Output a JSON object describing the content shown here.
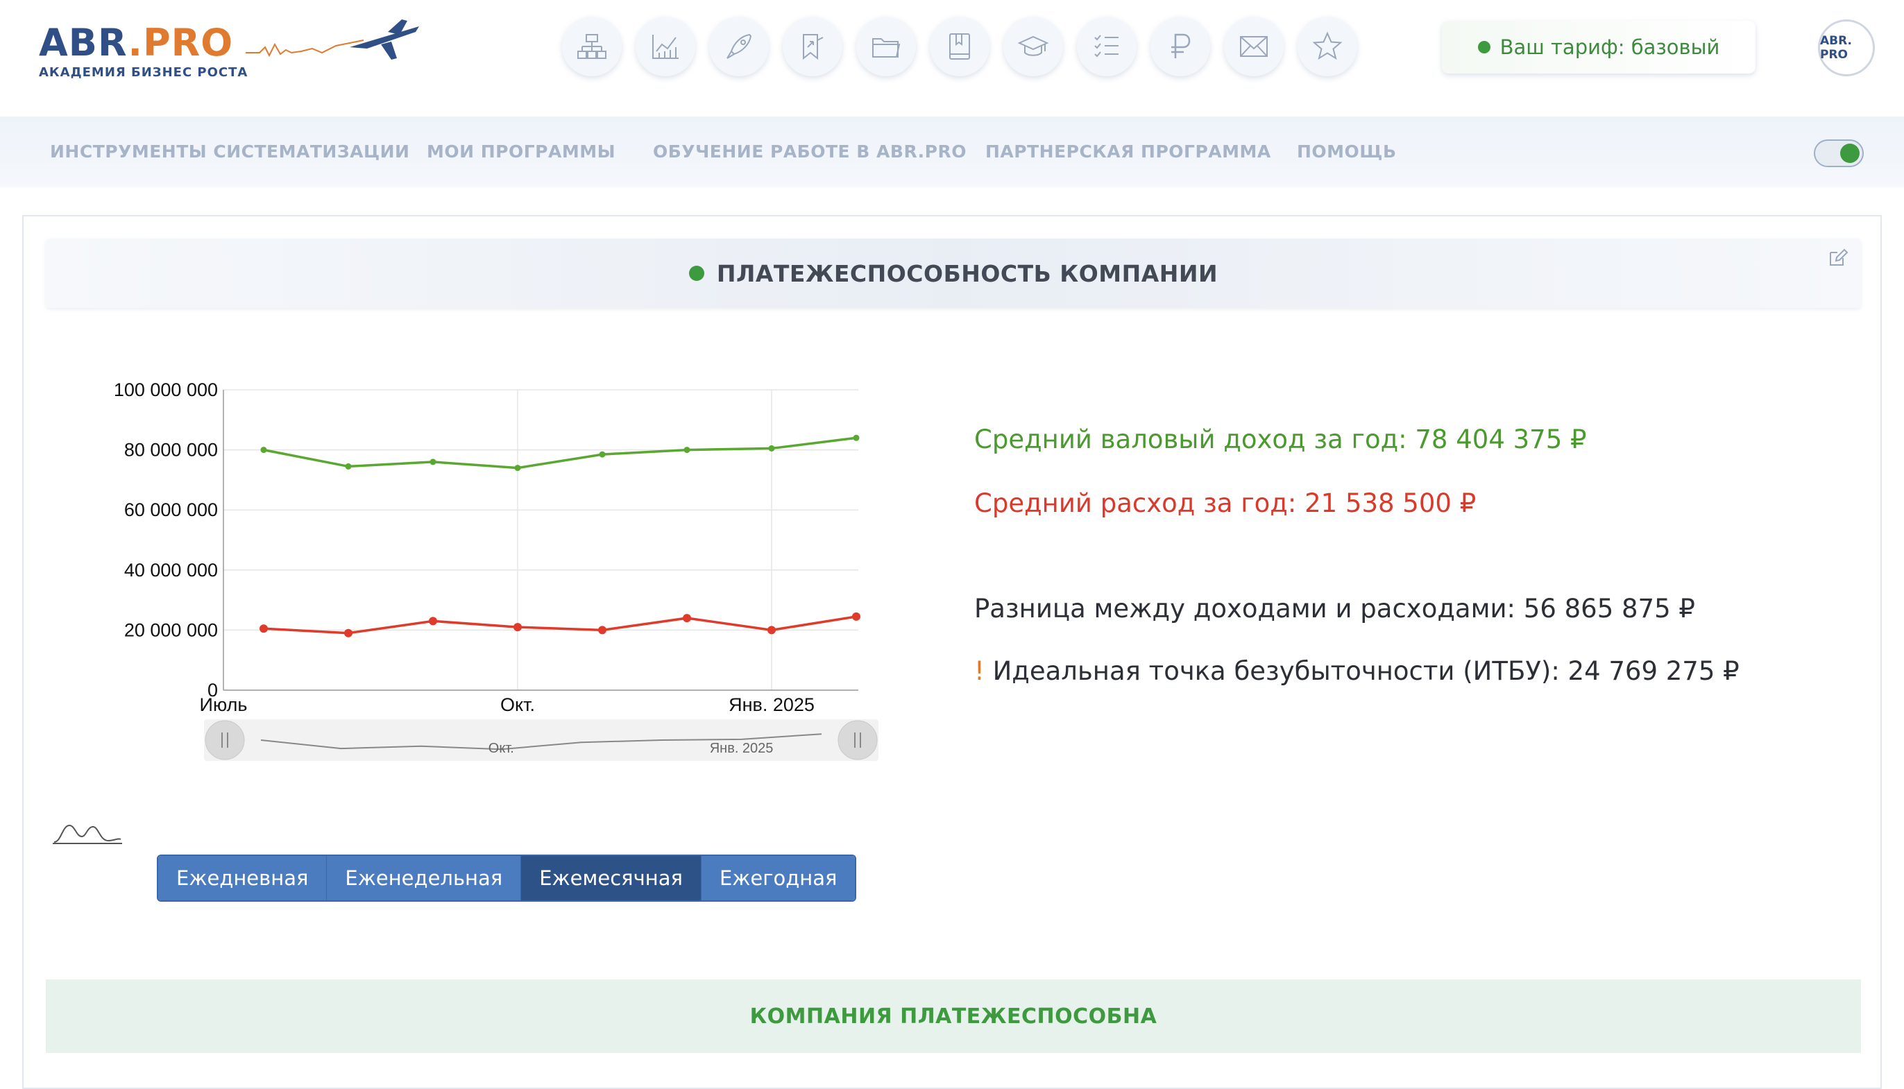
{
  "header": {
    "logo": {
      "abr": "ABR",
      "dot": ".",
      "pro": "PRO",
      "subtitle": "АКАДЕМИЯ БИЗНЕС РОСТА"
    },
    "icons": [
      "structure-icon",
      "chart-icon",
      "rocket-icon",
      "bookmark-icon",
      "folder-icon",
      "book-icon",
      "graduation-cap-icon",
      "checklist-icon",
      "ruble-icon",
      "mail-icon",
      "star-icon"
    ],
    "tariff": "Ваш тариф: базовый",
    "avatar_text": "ABR. PRO"
  },
  "nav": {
    "items": [
      "ИНСТРУМЕНТЫ СИСТЕМАТИЗАЦИИ",
      "МОИ ПРОГРАММЫ",
      "ОБУЧЕНИЕ РАБОТЕ В ABR.PRO",
      "ПАРТНЕРСКАЯ ПРОГРАММА",
      "ПОМОЩЬ"
    ],
    "toggle_on": true
  },
  "panel": {
    "title": "ПЛАТЕЖЕСПОСОБНОСТЬ КОМПАНИИ",
    "stats": {
      "income": "Средний валовый доход за год: 78 404 375 ₽",
      "expense": "Средний расход за год: 21 538 500 ₽",
      "diff": "Разница между доходами и расходами: 56 865 875 ₽",
      "itbu_mark": "!",
      "itbu": " Идеальная точка безубыточности (ИТБУ): 24 769 275 ₽"
    },
    "periods": [
      "Ежедневная",
      "Еженедельная",
      "Ежемесячная",
      "Ежегодная"
    ],
    "active_period": "Ежемесячная",
    "status": "КОМПАНИЯ ПЛАТЕЖЕСПОСОБНА"
  },
  "colors": {
    "income": "#5aa832",
    "expense": "#e03a2a",
    "accent_green": "#3e9a3e",
    "brand_blue": "#2f4f86",
    "brand_orange": "#e07a2e"
  },
  "chart_data": {
    "type": "line",
    "x": [
      "2024-07",
      "2024-08",
      "2024-09",
      "2024-10",
      "2024-11",
      "2024-12",
      "2025-01",
      "2025-02"
    ],
    "x_tick_labels": [
      {
        "x": "2024-07",
        "label": "Июль"
      },
      {
        "x": "2024-10",
        "label": "Окт."
      },
      {
        "x": "2025-01",
        "label": "Янв. 2025"
      }
    ],
    "series": [
      {
        "values": [
          80000000,
          74500000,
          76000000,
          74000000,
          78500000,
          80000000,
          80500000,
          84000000
        ],
        "color": "#5aa832"
      },
      {
        "values": [
          20500000,
          19000000,
          23000000,
          21000000,
          20000000,
          24000000,
          20000000,
          24500000
        ],
        "color": "#e03a2a"
      }
    ],
    "y_ticks": [
      "100 000 000",
      "80 000 000",
      "60 000 000",
      "40 000 000",
      "20 000 000",
      "0"
    ],
    "ylim": [
      0,
      100000000
    ],
    "grid": true,
    "navigator": {
      "tick_labels": [
        "Окт.",
        "Янв. 2025"
      ],
      "values": [
        80000000,
        74500000,
        76000000,
        74000000,
        78500000,
        80000000,
        80500000,
        84000000
      ]
    }
  }
}
